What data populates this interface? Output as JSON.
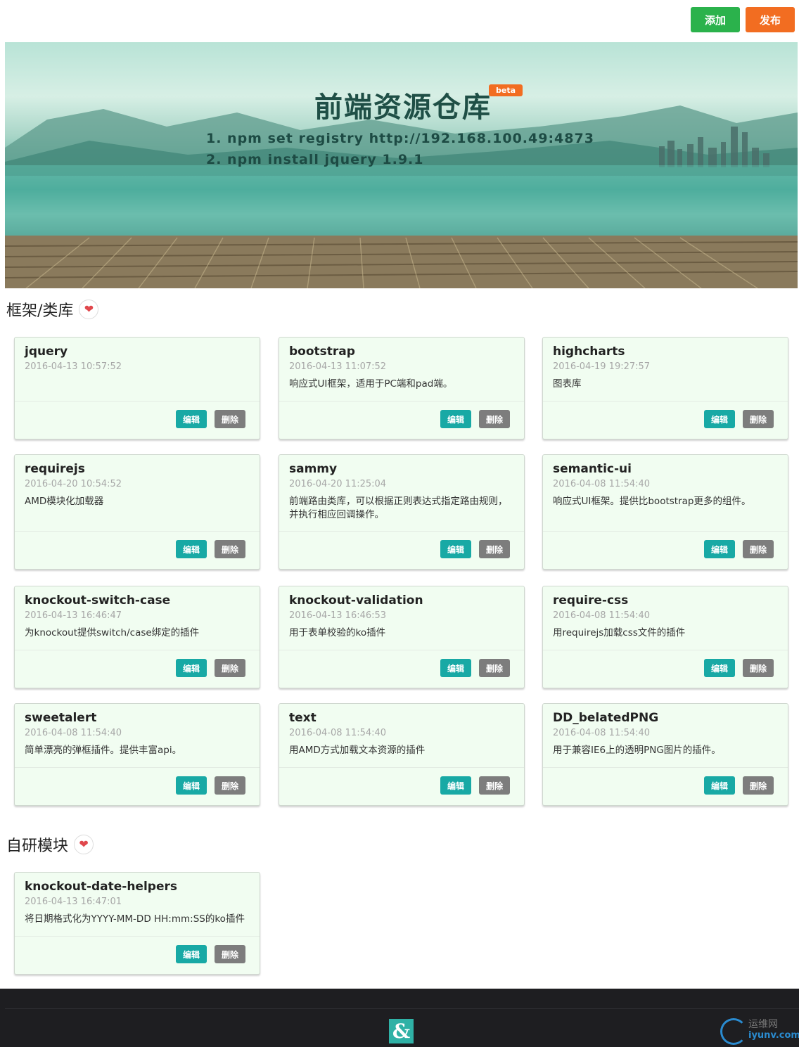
{
  "toolbar": {
    "add_label": "添加",
    "publish_label": "发布"
  },
  "colors": {
    "add": "#2bb24c",
    "publish": "#f26d21",
    "edit": "#18a9a5",
    "delete": "#7d7d7d",
    "card_bg": "#f1fdf1",
    "footer": "#1e1e21"
  },
  "banner": {
    "title": "前端资源仓库",
    "badge": "beta",
    "step1": "1.  npm  set  registry  http://192.168.100.49:4873",
    "step2": "2.  npm  install  jquery  1.9.1"
  },
  "section1": {
    "title": "框架/类库",
    "icon": "heart-icon"
  },
  "section2": {
    "title": "自研模块",
    "icon": "heart-icon"
  },
  "card_buttons": {
    "edit": "编辑",
    "delete": "删除"
  },
  "cards": [
    {
      "name": "jquery",
      "date": "2016-04-13 10:57:52",
      "desc": ""
    },
    {
      "name": "bootstrap",
      "date": "2016-04-13 11:07:52",
      "desc": "响应式UI框架，适用于PC端和pad端。"
    },
    {
      "name": "highcharts",
      "date": "2016-04-19 19:27:57",
      "desc": "图表库"
    },
    {
      "name": "requirejs",
      "date": "2016-04-20 10:54:52",
      "desc": "AMD模块化加载器"
    },
    {
      "name": "sammy",
      "date": "2016-04-20 11:25:04",
      "desc": "前端路由类库，可以根据正则表达式指定路由规则，并执行相应回调操作。"
    },
    {
      "name": "semantic-ui",
      "date": "2016-04-08 11:54:40",
      "desc": "响应式UI框架。提供比bootstrap更多的组件。"
    },
    {
      "name": "knockout-switch-case",
      "date": "2016-04-13 16:46:47",
      "desc": "为knockout提供switch/case绑定的插件"
    },
    {
      "name": "knockout-validation",
      "date": "2016-04-13 16:46:53",
      "desc": "用于表单校验的ko插件"
    },
    {
      "name": "require-css",
      "date": "2016-04-08 11:54:40",
      "desc": "用requirejs加载css文件的插件"
    },
    {
      "name": "sweetalert",
      "date": "2016-04-08 11:54:40",
      "desc": "简单漂亮的弹框插件。提供丰富api。"
    },
    {
      "name": "text",
      "date": "2016-04-08 11:54:40",
      "desc": "用AMD方式加载文本资源的插件"
    },
    {
      "name": "DD_belatedPNG",
      "date": "2016-04-08 11:54:40",
      "desc": "用于兼容IE6上的透明PNG图片的插件。"
    }
  ],
  "modules": [
    {
      "name": "knockout-date-helpers",
      "date": "2016-04-13 16:47:01",
      "desc": "将日期格式化为YYYY-MM-DD HH:mm:SS的ko插件"
    }
  ],
  "footer": {
    "logo": "&",
    "watermark_cn": "运维网",
    "watermark_en": "iyunv.com"
  }
}
